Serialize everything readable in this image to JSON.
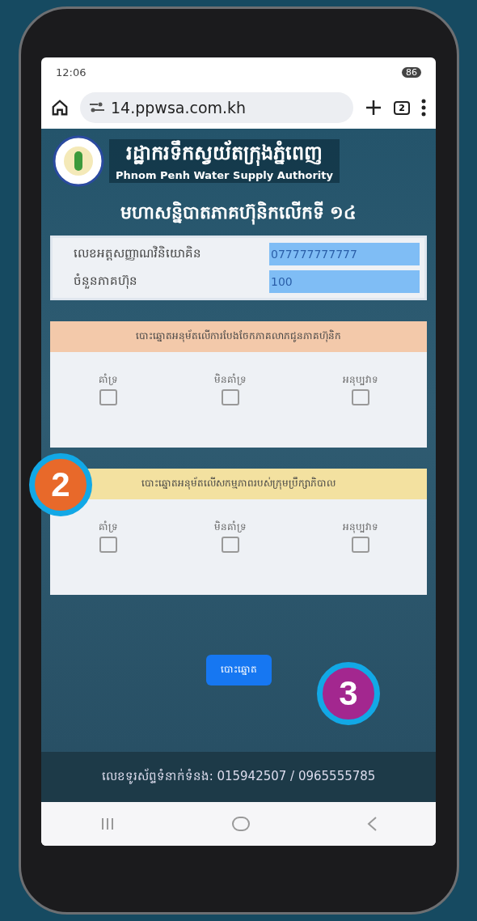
{
  "status_bar": {
    "time": "12:06",
    "battery": "86"
  },
  "browser": {
    "url": "14.ppwsa.com.kh",
    "tab_count": "2"
  },
  "header": {
    "title_km": "រដ្ឋាករទឹកស្វយ័តក្រុងភ្នំពេញ",
    "title_en": "Phnom Penh Water Supply Authority"
  },
  "page_title": "មហាសន្និបាតភាគហ៊ុនិកលើកទី ១៤",
  "info": [
    {
      "label": "លេខអត្តសញ្ញាណវិនិយោគិន",
      "value": "077777777777"
    },
    {
      "label": "ចំនួនភាគហ៊ុន",
      "value": "100"
    }
  ],
  "votes": [
    {
      "title": "បោះឆ្នោតអនុម័តលើការបែងចែកភាគលាភជូនភាគហ៊ុនិក",
      "color": "#f3c9aa",
      "options": [
        {
          "label": "គាំទ្រ",
          "checked": false
        },
        {
          "label": "មិនគាំទ្រ",
          "checked": false
        },
        {
          "label": "អនុប្បវាទ",
          "checked": false
        }
      ]
    },
    {
      "title": "បោះឆ្នោតអនុម័តលើសកម្មភាពរបស់ក្រុមប្រឹក្សាភិបាល",
      "color": "#f3e1a0",
      "options": [
        {
          "label": "គាំទ្រ",
          "checked": false
        },
        {
          "label": "មិនគាំទ្រ",
          "checked": false
        },
        {
          "label": "អនុប្បវាទ",
          "checked": false
        }
      ]
    }
  ],
  "submit_button": "បោះឆ្នោត",
  "footer": "លេខទូរស័ព្ទទំនាក់ទំនង: 015942507 / 0965555785",
  "callouts": [
    {
      "number": "2",
      "color": "#e8692a"
    },
    {
      "number": "3",
      "color": "#a3278f"
    }
  ]
}
